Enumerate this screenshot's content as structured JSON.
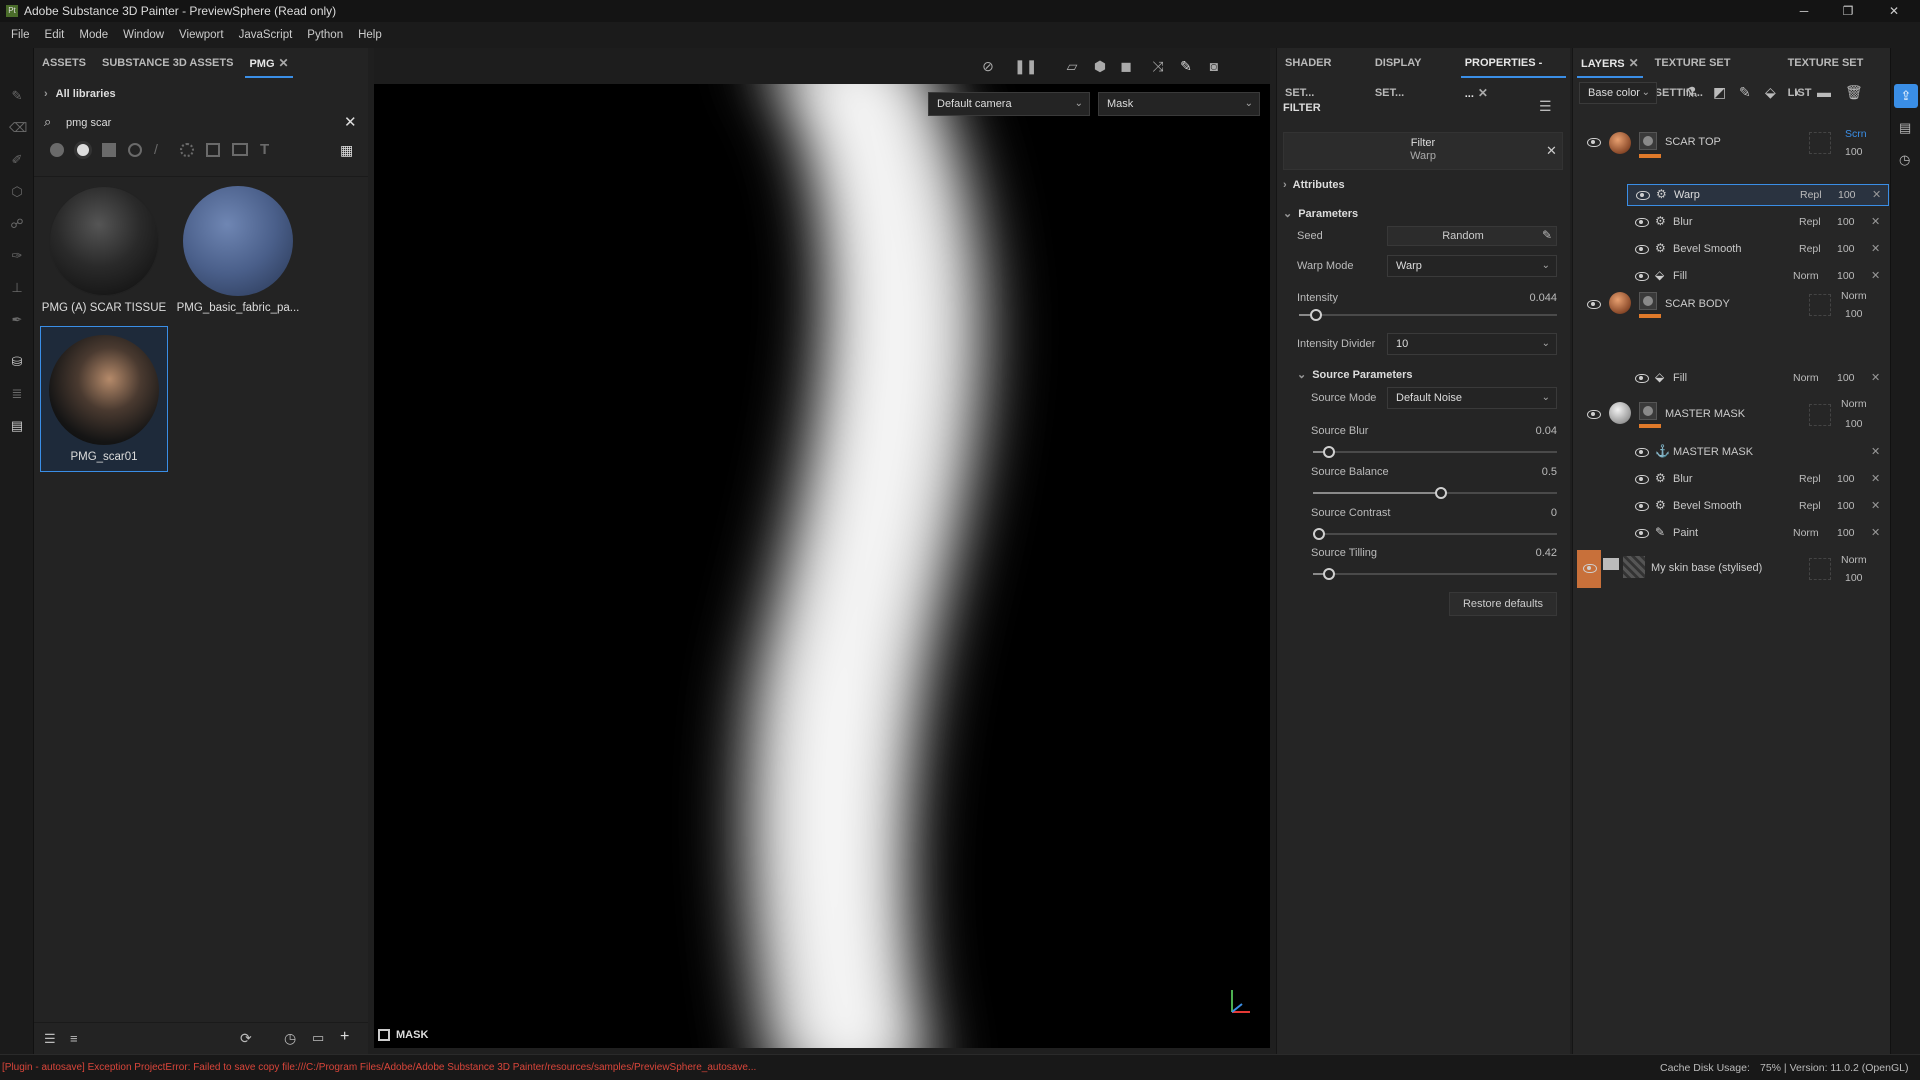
{
  "app": {
    "title": "Adobe Substance 3D Painter - PreviewSphere (Read only)",
    "logo": "Pt"
  },
  "window_controls": [
    "─",
    "❐",
    "✕"
  ],
  "menu": [
    "File",
    "Edit",
    "Mode",
    "Window",
    "Viewport",
    "JavaScript",
    "Python",
    "Help"
  ],
  "assets": {
    "tabs": [
      "ASSETS",
      "SUBSTANCE 3D ASSETS",
      "PMG"
    ],
    "breadcrumb": "All libraries",
    "search_value": "pmg scar",
    "items": [
      {
        "name": "PMG (A) SCAR TISSUE"
      },
      {
        "name": "PMG_basic_fabric_pa..."
      },
      {
        "name": "PMG_scar01"
      }
    ]
  },
  "viewport": {
    "camera": "Default camera",
    "channel": "Mask",
    "label": "MASK"
  },
  "properties": {
    "tabs": [
      "SHADER SET...",
      "DISPLAY SET...",
      "PROPERTIES - ..."
    ],
    "header": "FILTER",
    "filter_title": "Filter",
    "filter_sub": "Warp",
    "attributes": "Attributes",
    "parameters": "Parameters",
    "seed_label": "Seed",
    "seed_value": "Random",
    "warp_mode_label": "Warp Mode",
    "warp_mode_value": "Warp",
    "intensity_label": "Intensity",
    "intensity_value": "0.044",
    "intensity_fraction": 0.044,
    "divider_label": "Intensity Divider",
    "divider_value": "10",
    "source_params": "Source Parameters",
    "source_mode_label": "Source Mode",
    "source_mode_value": "Default Noise",
    "source_blur_label": "Source Blur",
    "source_blur_value": "0.04",
    "source_blur_fraction": 0.04,
    "source_balance_label": "Source Balance",
    "source_balance_value": "0.5",
    "source_balance_fraction": 0.5,
    "source_contrast_label": "Source Contrast",
    "source_contrast_value": "0",
    "source_contrast_fraction": 0,
    "source_tilling_label": "Source Tilling",
    "source_tilling_value": "0.42",
    "source_tilling_fraction": 0.04,
    "restore": "Restore defaults"
  },
  "layers": {
    "tabs": [
      "LAYERS",
      "TEXTURE SET SETTIN...",
      "TEXTURE SET LIST"
    ],
    "channel": "Base color",
    "rows": [
      {
        "name": "SCAR TOP",
        "blend": "Scrn",
        "opacity": "100"
      },
      {
        "name": "Warp",
        "blend": "Repl",
        "opacity": "100"
      },
      {
        "name": "Blur",
        "blend": "Repl",
        "opacity": "100"
      },
      {
        "name": "Bevel Smooth",
        "blend": "Repl",
        "opacity": "100"
      },
      {
        "name": "Fill",
        "blend": "Norm",
        "opacity": "100"
      },
      {
        "name": "SCAR BODY",
        "blend": "Norm",
        "opacity": "100"
      },
      {
        "name": "Fill",
        "blend": "Norm",
        "opacity": "100"
      },
      {
        "name": "MASTER MASK",
        "blend": "Norm",
        "opacity": "100"
      },
      {
        "name": "MASTER MASK",
        "blend": "",
        "opacity": ""
      },
      {
        "name": "Blur",
        "blend": "Repl",
        "opacity": "100"
      },
      {
        "name": "Bevel Smooth",
        "blend": "Repl",
        "opacity": "100"
      },
      {
        "name": "Paint",
        "blend": "Norm",
        "opacity": "100"
      },
      {
        "name": "My skin base (stylised)",
        "blend": "Norm",
        "opacity": "100"
      }
    ]
  },
  "status": {
    "error": "[Plugin - autosave] Exception ProjectError: Failed to save copy file:///C:/Program Files/Adobe/Adobe Substance 3D Painter/resources/samples/PreviewSphere_autosave...",
    "cache": "Cache Disk Usage:",
    "version": "75% | Version: 11.0.2 (OpenGL)"
  },
  "colors": {
    "accent": "#3a8ee6",
    "layer_orange": "#e07a2a",
    "error_red": "#d9453a"
  }
}
